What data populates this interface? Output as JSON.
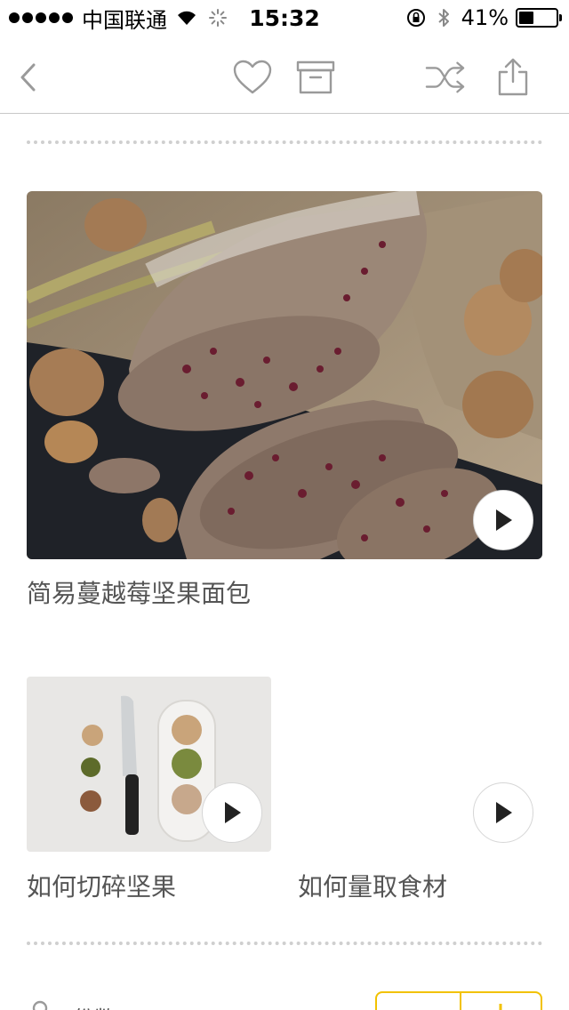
{
  "status_bar": {
    "carrier": "中国联通",
    "time": "15:32",
    "battery_pct": "41%",
    "battery_level": 0.41
  },
  "nav": {
    "icons": [
      "back-chevron-icon",
      "heart-icon",
      "archive-box-icon",
      "shuffle-icon",
      "share-icon"
    ],
    "icon_color": "#9a9a9a"
  },
  "main": {
    "featured": {
      "title": "简易蔓越莓坚果面包",
      "play_icon": "play-icon"
    },
    "videos": [
      {
        "title": "如何切碎坚果",
        "play_icon": "play-icon"
      },
      {
        "title": "如何量取食材",
        "play_icon": "play-icon"
      }
    ]
  },
  "bottom": {
    "servings_label": "份数",
    "stepper_accent": "#f2c200"
  }
}
